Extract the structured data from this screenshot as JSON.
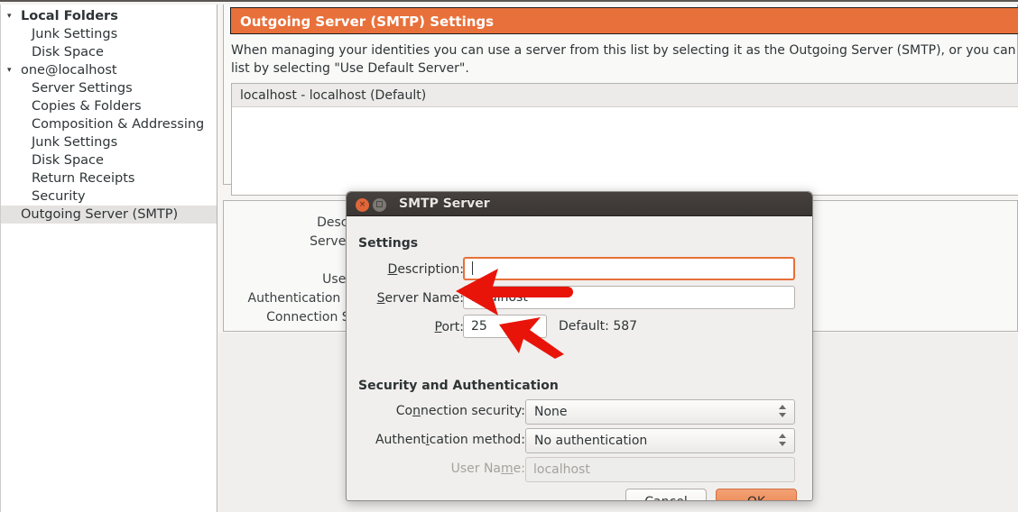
{
  "sidebar": {
    "items": [
      {
        "label": "Local Folders",
        "level": "root",
        "twisty": "▾",
        "selected": false
      },
      {
        "label": "Junk Settings",
        "level": "child",
        "twisty": "",
        "selected": false
      },
      {
        "label": "Disk Space",
        "level": "child",
        "twisty": "",
        "selected": false
      },
      {
        "label": "one@localhost",
        "level": "account",
        "twisty": "▾",
        "selected": false
      },
      {
        "label": "Server Settings",
        "level": "child",
        "twisty": "",
        "selected": false
      },
      {
        "label": "Copies & Folders",
        "level": "child",
        "twisty": "",
        "selected": false
      },
      {
        "label": "Composition & Addressing",
        "level": "child",
        "twisty": "",
        "selected": false
      },
      {
        "label": "Junk Settings",
        "level": "child",
        "twisty": "",
        "selected": false
      },
      {
        "label": "Disk Space",
        "level": "child",
        "twisty": "",
        "selected": false
      },
      {
        "label": "Return Receipts",
        "level": "child",
        "twisty": "",
        "selected": false
      },
      {
        "label": "Security",
        "level": "child",
        "twisty": "",
        "selected": false
      },
      {
        "label": "Outgoing Server (SMTP)",
        "level": "account",
        "twisty": "",
        "selected": true
      }
    ]
  },
  "main": {
    "banner_title": "Outgoing Server (SMTP) Settings",
    "description": "When managing your identities you can use a server from this list by selecting it as the Outgoing Server (SMTP), or you can use the de\nlist by selecting \"Use Default Server\".",
    "server_list": [
      "localhost - localhost (Default)"
    ],
    "background_labels": [
      "Descrip",
      "Server N",
      "User N",
      "Authentication me",
      "Connection Sec"
    ]
  },
  "dialog": {
    "title": "SMTP Server",
    "close_icon": "×",
    "settings_section": "Settings",
    "security_section": "Security and Authentication",
    "fields": {
      "description_label": "Description:",
      "description_value": "",
      "server_name_label": "Server Name:",
      "server_name_value": "localhost",
      "port_label": "Port:",
      "port_value": "25",
      "default_port_text": "Default:  587",
      "connection_security_label": "Connection security:",
      "connection_security_value": "None",
      "auth_method_label": "Authentication method:",
      "auth_method_value": "No authentication",
      "user_name_label": "User Name:",
      "user_name_value": "localhost"
    },
    "buttons": {
      "cancel": "Cancel",
      "ok": "OK"
    }
  },
  "colors": {
    "banner_orange": "#e8703a",
    "focus_orange": "#e8703a",
    "primary_button": "#ea7c45",
    "annotation_red": "#e8140a",
    "selection_gray": "#e4e2e0"
  }
}
